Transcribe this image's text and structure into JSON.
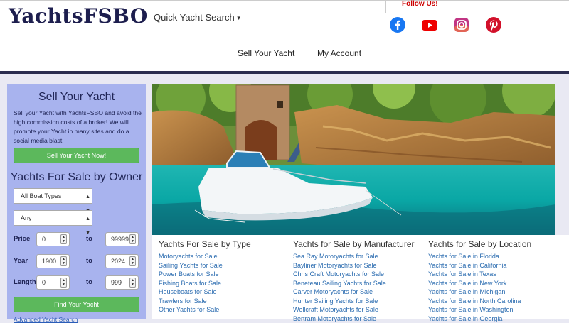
{
  "header": {
    "logo": "YachtsFSBO",
    "quick_search": "Quick Yacht Search",
    "follow_us": "Follow Us!",
    "nav": [
      "Sell Your Yacht",
      "My Account"
    ]
  },
  "social_icons": [
    "facebook-icon",
    "youtube-icon",
    "instagram-icon",
    "pinterest-icon"
  ],
  "sidebar": {
    "sell_title": "Sell Your Yacht",
    "sell_text": "Sell your Yacht with YachtsFSBO and avoid the high commission costs of a broker! We will promote your Yacht in many sites and do a social media blast!",
    "sell_button": "Sell Your Yacht Now!",
    "search_title": "Yachts For Sale by Owner",
    "boat_type": "All Boat Types",
    "select2": "Any",
    "price_label": "Price",
    "price_min": "0",
    "price_max": "99999",
    "year_label": "Year",
    "year_min": "1900",
    "year_max": "2024",
    "length_label": "Length",
    "length_min": "0",
    "length_max": "999",
    "to": "to",
    "find_button": "Find Your Yacht",
    "advanced": "Advanced Yacht Search"
  },
  "columns": [
    {
      "title": "Yachts For Sale by Type",
      "links": [
        "Motoryachts for Sale",
        "Sailing Yachts for Sale",
        "Power Boats for Sale",
        "Fishing Boats for Sale",
        "Houseboats for Sale",
        "Trawlers for Sale",
        "Other Yachts for Sale"
      ]
    },
    {
      "title": "Yachts for Sale by Manufacturer",
      "links": [
        "Sea Ray Motoryachts for Sale",
        "Bayliner Motoryachts for Sale",
        "Chris Craft Motoryachts for Sale",
        "Beneteau Sailing Yachts for Sale",
        "Carver Motoryachts for Sale",
        "Hunter Sailing Yachts for Sale",
        "Wellcraft Motoryachts for Sale",
        "Bertram Motoryachts for Sale"
      ]
    },
    {
      "title": "Yachts for Sale by Location",
      "links": [
        "Yachts for Sale in Florida",
        "Yachts for Sale in California",
        "Yachts for Sale in Texas",
        "Yachts for Sale in New York",
        "Yachts for Sale in Michigan",
        "Yachts for Sale in North Carolina",
        "Yachts for Sale in Washington",
        "Yachts for Sale in Georgia"
      ]
    }
  ]
}
